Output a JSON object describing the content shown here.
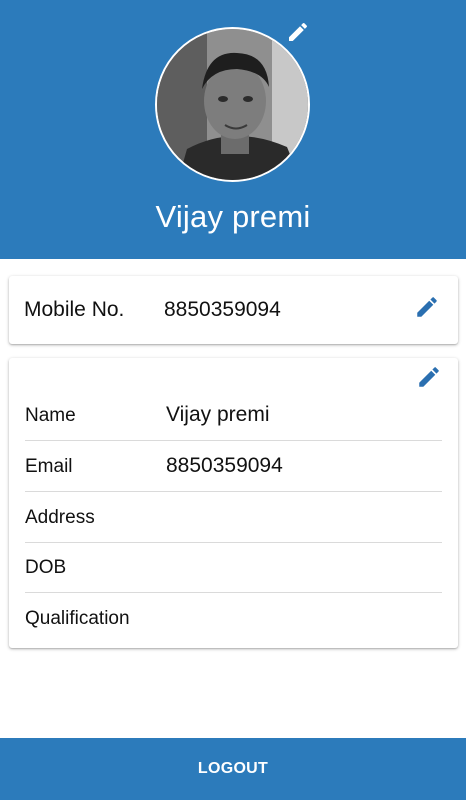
{
  "profile": {
    "name": "Vijay premi",
    "edit_icon": "pencil-icon"
  },
  "mobile": {
    "label": "Mobile No.",
    "value": "8850359094",
    "edit_icon": "pencil-icon"
  },
  "details": {
    "edit_icon": "pencil-icon",
    "rows": [
      {
        "label": "Name",
        "value": "Vijay premi"
      },
      {
        "label": "Email",
        "value": "8850359094"
      },
      {
        "label": "Address",
        "value": ""
      },
      {
        "label": "DOB",
        "value": ""
      },
      {
        "label": "Qualification",
        "value": ""
      }
    ]
  },
  "logout": {
    "label": "LOGOUT"
  },
  "colors": {
    "primary": "#2c7bbb",
    "edit_icon_dark": "#2a6fb0",
    "edit_icon_light": "#ffffff"
  }
}
